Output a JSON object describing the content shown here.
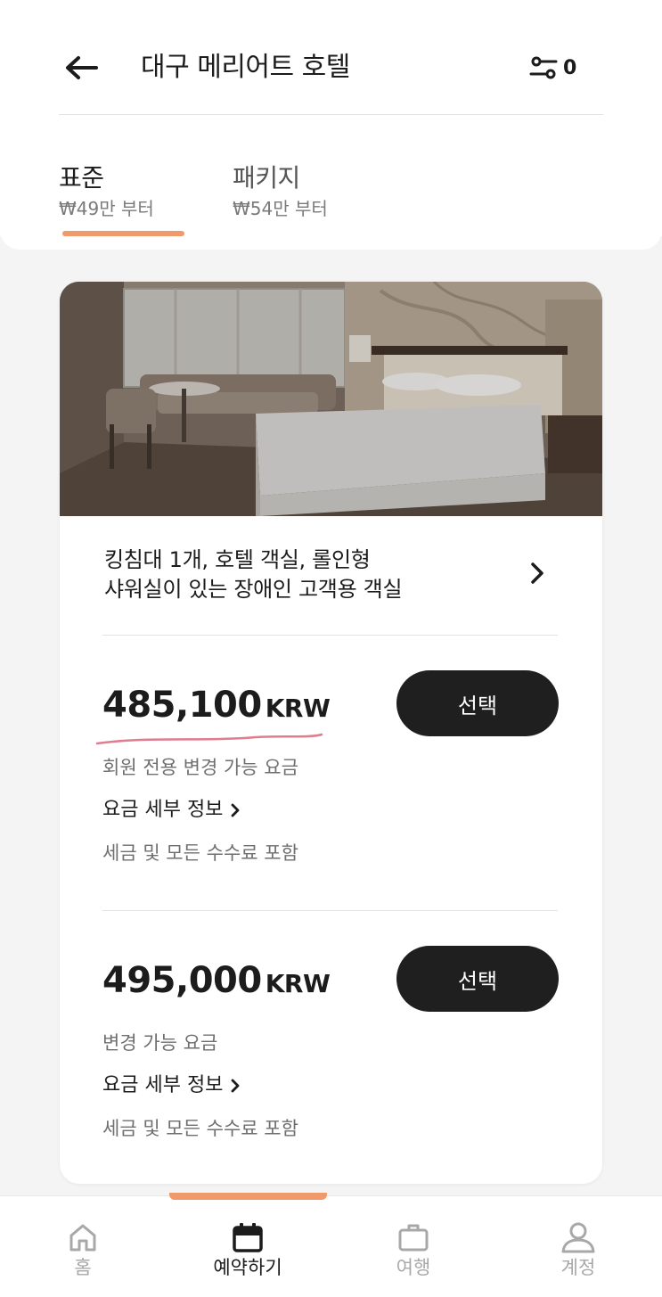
{
  "header": {
    "title": "대구 메리어트 호텔",
    "filter_count": "0"
  },
  "tabs": [
    {
      "label": "표준",
      "sub": "₩49만 부터",
      "active": true
    },
    {
      "label": "패키지",
      "sub": "₩54만 부터",
      "active": false
    }
  ],
  "room": {
    "name_line1": "킹침대 1개, 호텔 객실, 롤인형",
    "name_line2": "샤워실이 있는 장애인 고객용 객실"
  },
  "rates": [
    {
      "price": "485,100",
      "currency": "KRW",
      "select_label": "선택",
      "type": "회원 전용 변경 가능 요금",
      "details_label": "요금 세부 정보",
      "tax_note": "세금 및 모든 수수료 포함"
    },
    {
      "price": "495,000",
      "currency": "KRW",
      "select_label": "선택",
      "type": "변경 가능 요금",
      "details_label": "요금 세부 정보",
      "tax_note": "세금 및 모든 수수료 포함"
    }
  ],
  "nav": [
    {
      "label": "홈",
      "icon": "home-icon",
      "active": false
    },
    {
      "label": "예약하기",
      "icon": "calendar-icon",
      "active": true
    },
    {
      "label": "여행",
      "icon": "briefcase-icon",
      "active": false
    },
    {
      "label": "계정",
      "icon": "user-icon",
      "active": false
    }
  ],
  "colors": {
    "accent": "#f0996a",
    "button": "#1f1f1f",
    "annotation": "#d9657a"
  }
}
